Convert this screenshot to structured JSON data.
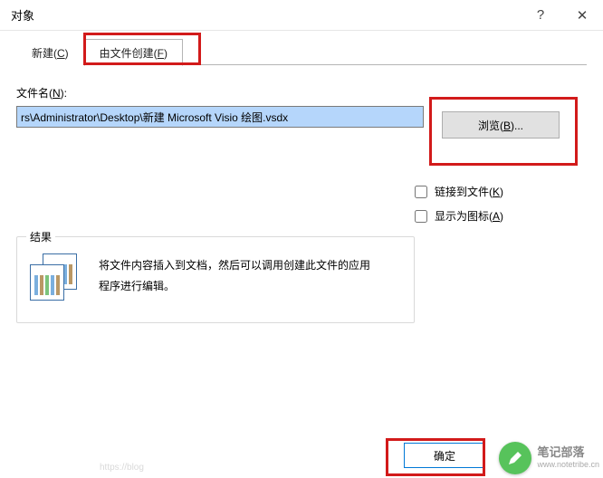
{
  "titlebar": {
    "title": "对象"
  },
  "tabs": {
    "new": "新建(",
    "new_hotkey": "C",
    "new_close": ")",
    "file": "由文件创建(",
    "file_hotkey": "F",
    "file_close": ")"
  },
  "filename": {
    "label_pre": "文件名(",
    "label_hotkey": "N",
    "label_post": "):",
    "value": "rs\\Administrator\\Desktop\\新建 Microsoft Visio 绘图.vsdx"
  },
  "browse": {
    "label_pre": "浏览(",
    "label_hotkey": "B",
    "label_post": ")..."
  },
  "checks": {
    "link_pre": "链接到文件(",
    "link_hotkey": "K",
    "link_post": ")",
    "icon_pre": "显示为图标(",
    "icon_hotkey": "A",
    "icon_post": ")"
  },
  "result": {
    "legend": "结果",
    "text": "将文件内容插入到文档，然后可以调用创建此文件的应用程序进行编辑。"
  },
  "footer": {
    "ok": "确定"
  },
  "watermark": {
    "line1": "笔记部落",
    "line2": "www.notetribe.cn"
  },
  "faded_url": "https://blog"
}
